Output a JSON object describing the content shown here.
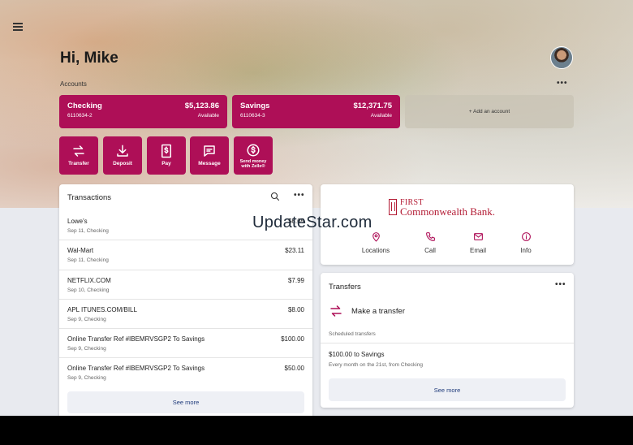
{
  "header": {
    "greeting": "Hi, Mike",
    "accounts_label": "Accounts",
    "more_glyph": "•••"
  },
  "accounts": [
    {
      "name": "Checking",
      "number": "6110634-2",
      "balance": "$5,123.86",
      "status": "Available"
    },
    {
      "name": "Savings",
      "number": "6110634-3",
      "balance": "$12,371.75",
      "status": "Available"
    }
  ],
  "add_account_label": "+ Add an account",
  "quick_actions": [
    {
      "label": "Transfer",
      "icon": "transfer-icon"
    },
    {
      "label": "Deposit",
      "icon": "download-icon"
    },
    {
      "label": "Pay",
      "icon": "bill-icon"
    },
    {
      "label": "Message",
      "icon": "message-icon"
    },
    {
      "label_line1": "Send money",
      "label_line2": "with Zelle®",
      "icon": "dollar-circle-icon"
    }
  ],
  "transactions": {
    "title": "Transactions",
    "more_glyph": "•••",
    "items": [
      {
        "desc": "Lowe's",
        "meta": "Sep 11, Checking",
        "amount": "$6.65"
      },
      {
        "desc": "Wal-Mart",
        "meta": "Sep 11, Checking",
        "amount": "$23.11"
      },
      {
        "desc": "NETFLIX.COM",
        "meta": "Sep 10, Checking",
        "amount": "$7.99"
      },
      {
        "desc": "APL ITUNES.COM/BILL",
        "meta": "Sep 9, Checking",
        "amount": "$8.00"
      },
      {
        "desc": "Online Transfer Ref #IBEMRVSGP2 To Savings",
        "meta": "Sep 9, Checking",
        "amount": "$100.00"
      },
      {
        "desc": "Online Transfer Ref #IBEMRVSGP2 To Savings",
        "meta": "Sep 9, Checking",
        "amount": "$50.00"
      }
    ],
    "see_more": "See more"
  },
  "bank": {
    "name_line1": "FIRST",
    "name_line2": "Commonwealth Bank.",
    "actions": [
      {
        "label": "Locations",
        "icon": "location-pin-icon"
      },
      {
        "label": "Call",
        "icon": "phone-icon"
      },
      {
        "label": "Email",
        "icon": "email-icon"
      },
      {
        "label": "Info",
        "icon": "info-icon"
      }
    ]
  },
  "transfers": {
    "title": "Transfers",
    "more_glyph": "•••",
    "make_label": "Make a transfer",
    "scheduled_label": "Scheduled transfers",
    "scheduled": {
      "title": "$100.00 to Savings",
      "detail": "Every month on the 21st, from Checking"
    },
    "see_more": "See more"
  },
  "watermark": "UpdateStar.com",
  "colors": {
    "brand": "#ae0f57",
    "bank_red": "#b31b34",
    "link": "#1e3a7a"
  }
}
